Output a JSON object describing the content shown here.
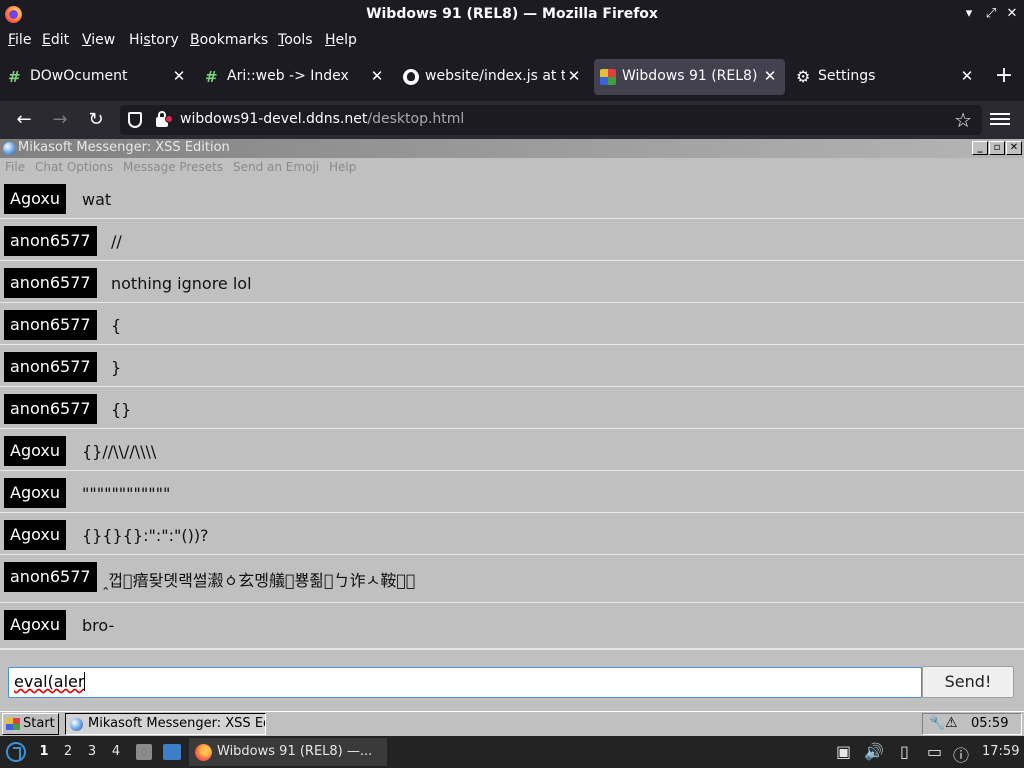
{
  "window": {
    "title": "Wibdows 91 (REL8) — Mozilla Firefox",
    "minimize": "▾",
    "maximize": "⤢",
    "close": "✕"
  },
  "menubar": [
    {
      "label": "File",
      "key": "F",
      "rest": "ile"
    },
    {
      "label": "Edit",
      "key": "E",
      "rest": "dit"
    },
    {
      "label": "View",
      "key": "V",
      "rest": "iew"
    },
    {
      "label": "History",
      "key": "s",
      "pre": "Hi",
      "rest": "tory"
    },
    {
      "label": "Bookmarks",
      "key": "B",
      "rest": "ookmarks"
    },
    {
      "label": "Tools",
      "key": "T",
      "rest": "ools"
    },
    {
      "label": "Help",
      "key": "H",
      "rest": "elp"
    }
  ],
  "tabs": [
    {
      "label": "DOwOcument",
      "icon": "hash-icon",
      "close": "✕"
    },
    {
      "label": "Ari::web -> Index",
      "icon": "hash-icon",
      "close": "✕"
    },
    {
      "label": "website/index.js at test",
      "icon": "github-icon",
      "close": "✕"
    },
    {
      "label": "Wibdows 91 (REL8)",
      "icon": "windows91-icon",
      "close": "✕",
      "active": true
    },
    {
      "label": "Settings",
      "icon": "gear-icon",
      "close": "✕"
    }
  ],
  "newtab": "+",
  "nav": {
    "back": "←",
    "forward": "→",
    "reload": "↻",
    "url_host": "wibdows91-devel.ddns.net",
    "url_path": "/desktop.html",
    "star": "☆"
  },
  "app": {
    "title": "Mikasoft Messenger: XSS Edition",
    "buttons": {
      "minimize": "_",
      "maximize": "▫",
      "close": "✕"
    },
    "menu": [
      "File",
      "Chat Options",
      "Message Presets",
      "Send an Emoji",
      "Help"
    ],
    "messages": [
      {
        "user": "Agoxu",
        "text": "wat"
      },
      {
        "user": "anon6577",
        "text": "//"
      },
      {
        "user": "anon6577",
        "text": "nothing ignore lol"
      },
      {
        "user": "anon6577",
        "text": "{"
      },
      {
        "user": "anon6577",
        "text": "}"
      },
      {
        "user": "anon6577",
        "text": "{}"
      },
      {
        "user": "Agoxu",
        "text": "{}//\\\\//\\\\\\\\"
      },
      {
        "user": "Agoxu",
        "text": "\"\"\"\"\"\"\"\"\"\"\"\""
      },
      {
        "user": "Agoxu",
        "text": "{}{}{}:\":\":\"())?"
      },
      {
        "user": "anon6577",
        "text": "ꞈ껍\u0000瘖돶뎻랙썰瀫ㆁ玄멩艤\u0000뿅죎\u0000ㄅ诈ㅅ鞍\u0000\u0000"
      },
      {
        "user": "Agoxu",
        "text": "bro-"
      }
    ],
    "input_value": "eval(aler",
    "send_label": "Send!"
  },
  "w91_taskbar": {
    "start": "Start",
    "task": "Mikasoft Messenger: XSS Edition",
    "clock": "05:59"
  },
  "panel": {
    "workspaces": [
      "1",
      "2",
      "3",
      "4"
    ],
    "task": "Wibdows 91 (REL8) —...",
    "clock": "17:59"
  }
}
